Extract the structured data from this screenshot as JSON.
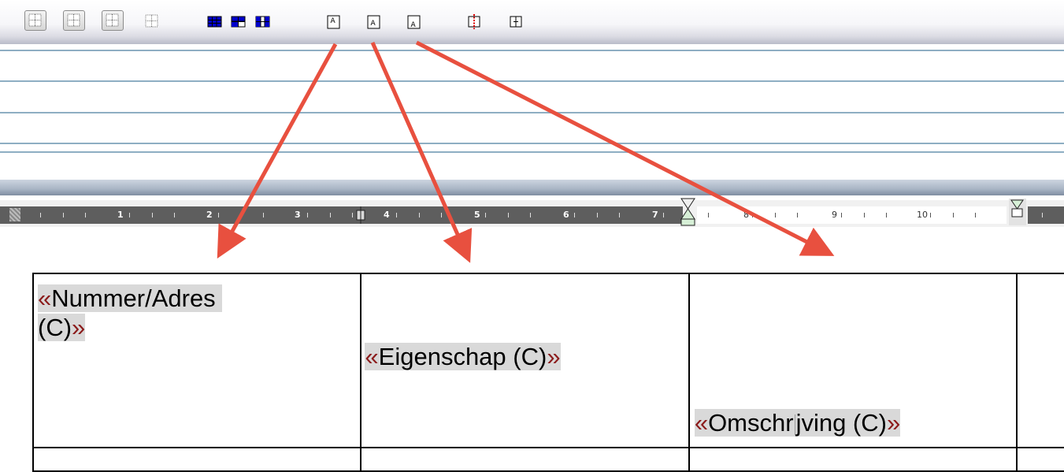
{
  "toolbar": {
    "buttons": [
      {
        "name": "table-grid-button-1",
        "icon": "table-grid-icon"
      },
      {
        "name": "table-grid-button-2",
        "icon": "table-grid-icon"
      },
      {
        "name": "table-grid-button-3",
        "icon": "table-grid-icon"
      },
      {
        "name": "table-grid-button-4",
        "icon": "table-grid-icon"
      },
      {
        "name": "table-blue-grid-button",
        "icon": "table-blue-grid-icon"
      },
      {
        "name": "table-split-horizontal-button",
        "icon": "table-split-icon"
      },
      {
        "name": "table-split-vertical-button",
        "icon": "table-split-icon"
      },
      {
        "name": "align-top-button",
        "icon": "align-top-icon",
        "letter": "A"
      },
      {
        "name": "align-middle-button",
        "icon": "align-middle-icon",
        "letter": "A"
      },
      {
        "name": "align-bottom-button",
        "icon": "align-bottom-icon",
        "letter": "A"
      },
      {
        "name": "column-red-divider-button",
        "icon": "column-divider-icon"
      },
      {
        "name": "column-divider-button",
        "icon": "column-divider-icon"
      }
    ]
  },
  "ruler": {
    "numbers": [
      "1",
      "2",
      "3",
      "4",
      "5",
      "6",
      "7",
      "8",
      "9",
      "10"
    ]
  },
  "table": {
    "cells": {
      "nummer": {
        "open": "«",
        "text": "Nummer/Adres",
        "text2": "(C)",
        "close": "»"
      },
      "eigenschap": {
        "open": "«",
        "text": "Eigenschap (C)",
        "close": "»"
      },
      "omschrijving": {
        "open": "«",
        "text_a": "Omschr",
        "text_b": "jving (C)",
        "close": "»"
      }
    }
  },
  "colors": {
    "arrow": "#e8503f",
    "field_bg": "#d9d9d9",
    "chevron": "#8b1a1a",
    "ruler_dark": "#5e5e5e"
  }
}
